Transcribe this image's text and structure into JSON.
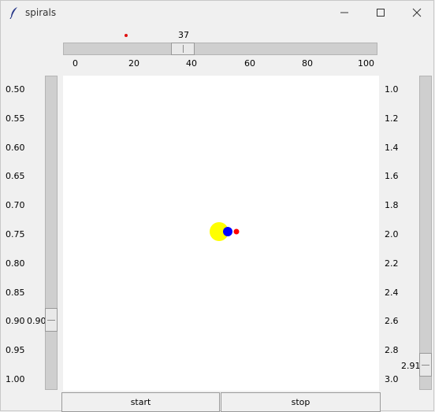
{
  "window": {
    "title": "spirals"
  },
  "top_scale": {
    "value": "37",
    "ticks": [
      "0",
      "20",
      "40",
      "60",
      "80",
      "100"
    ]
  },
  "left_scale": {
    "value": "0.90",
    "ticks": [
      "0.50",
      "0.55",
      "0.60",
      "0.65",
      "0.70",
      "0.75",
      "0.80",
      "0.85",
      "0.90",
      "0.95",
      "1.00"
    ]
  },
  "right_scale": {
    "value": "2.91",
    "ticks": [
      "1.0",
      "1.2",
      "1.4",
      "1.6",
      "1.8",
      "2.0",
      "2.2",
      "2.4",
      "2.6",
      "2.8",
      "3.0"
    ]
  },
  "buttons": {
    "start": "start",
    "stop": "stop"
  },
  "colors": {
    "sun": "#ffff00",
    "planet": "#0000ff",
    "moon": "#ff0000"
  }
}
